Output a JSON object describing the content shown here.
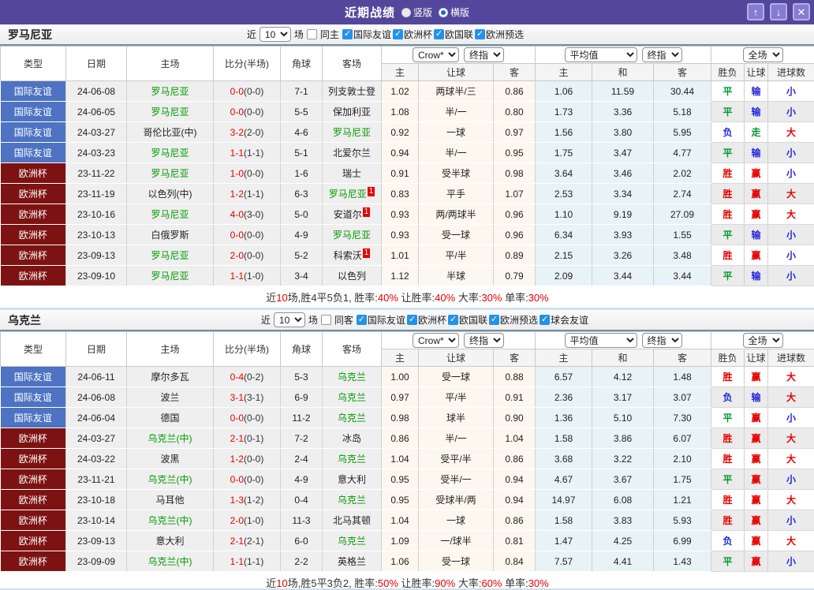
{
  "titlebar": {
    "title": "近期战绩",
    "radio_vertical": "竖版",
    "radio_horizontal": "横版",
    "selected_mode": "横版",
    "button_up": "↑",
    "button_down": "↓",
    "button_close": "✕"
  },
  "palette": {
    "titlebar_purple": "#54479b",
    "friendly_blue": "#4d73c2",
    "eurocup_dark_red": "#7d1212",
    "team_green": "#009900",
    "score_red": "#e60000",
    "result_red": "#e60000",
    "result_green": "#009933",
    "result_blue": "#2626d9",
    "checkbox_blue": "#2492ea"
  },
  "header": {
    "bookmaker_dd": "Crow*",
    "final_dd": "终指",
    "avg_dd": "平均值",
    "avg_final_dd": "终指",
    "scope_dd": "全场",
    "col_type": "类型",
    "col_date": "日期",
    "col_home": "主场",
    "col_score": "比分(半场)",
    "col_corner": "角球",
    "col_away": "客场",
    "col_odds_home": "主",
    "col_odds_hcp": "让球",
    "col_odds_away": "客",
    "col_avg_home": "主",
    "col_avg_draw": "和",
    "col_avg_away": "客",
    "col_res_wdl": "胜负",
    "col_res_hcp": "让球",
    "col_res_goals": "进球数"
  },
  "sections": [
    {
      "team": "罗马尼亚",
      "filters": {
        "recent_label": "近",
        "count": "10",
        "games_label": "场",
        "same_label": "同主",
        "same_checked": false,
        "leagues": [
          "国际友谊",
          "欧洲杯",
          "欧国联",
          "欧洲预选"
        ]
      },
      "rows": [
        {
          "type": "国际友谊",
          "tc": "blue",
          "date": "24-06-08",
          "home": {
            "t": "罗马尼亚",
            "hl": true
          },
          "score": [
            "0-0",
            "0-0"
          ],
          "corner": "7-1",
          "away": {
            "t": "列支敦士登",
            "hl": false
          },
          "odds": [
            "1.02",
            "两球半/三",
            "0.86"
          ],
          "avg": [
            "1.06",
            "11.59",
            "30.44"
          ],
          "res": [
            [
              "平",
              "g"
            ],
            [
              "输",
              "b"
            ],
            [
              "小",
              "b"
            ]
          ]
        },
        {
          "type": "国际友谊",
          "tc": "blue",
          "date": "24-06-05",
          "home": {
            "t": "罗马尼亚",
            "hl": true
          },
          "score": [
            "0-0",
            "0-0"
          ],
          "corner": "5-5",
          "away": {
            "t": "保加利亚",
            "hl": false
          },
          "odds": [
            "1.08",
            "半/一",
            "0.80"
          ],
          "avg": [
            "1.73",
            "3.36",
            "5.18"
          ],
          "res": [
            [
              "平",
              "g"
            ],
            [
              "输",
              "b"
            ],
            [
              "小",
              "b"
            ]
          ]
        },
        {
          "type": "国际友谊",
          "tc": "blue",
          "date": "24-03-27",
          "home": {
            "t": "哥伦比亚(中)",
            "hl": false
          },
          "score": [
            "3-2",
            "2-0"
          ],
          "corner": "4-6",
          "away": {
            "t": "罗马尼亚",
            "hl": true
          },
          "odds": [
            "0.92",
            "一球",
            "0.97"
          ],
          "avg": [
            "1.56",
            "3.80",
            "5.95"
          ],
          "res": [
            [
              "负",
              "b"
            ],
            [
              "走",
              "g"
            ],
            [
              "大",
              "r"
            ]
          ]
        },
        {
          "type": "国际友谊",
          "tc": "blue",
          "date": "24-03-23",
          "home": {
            "t": "罗马尼亚",
            "hl": true
          },
          "score": [
            "1-1",
            "1-1"
          ],
          "corner": "5-1",
          "away": {
            "t": "北爱尔兰",
            "hl": false
          },
          "odds": [
            "0.94",
            "半/一",
            "0.95"
          ],
          "avg": [
            "1.75",
            "3.47",
            "4.77"
          ],
          "res": [
            [
              "平",
              "g"
            ],
            [
              "输",
              "b"
            ],
            [
              "小",
              "b"
            ]
          ]
        },
        {
          "type": "欧洲杯",
          "tc": "dred",
          "date": "23-11-22",
          "home": {
            "t": "罗马尼亚",
            "hl": true
          },
          "score": [
            "1-0",
            "0-0"
          ],
          "corner": "1-6",
          "away": {
            "t": "瑞士",
            "hl": false
          },
          "odds": [
            "0.91",
            "受半球",
            "0.98"
          ],
          "avg": [
            "3.64",
            "3.46",
            "2.02"
          ],
          "res": [
            [
              "胜",
              "r"
            ],
            [
              "赢",
              "r"
            ],
            [
              "小",
              "b"
            ]
          ]
        },
        {
          "type": "欧洲杯",
          "tc": "dred",
          "date": "23-11-19",
          "home": {
            "t": "以色列(中)",
            "hl": false
          },
          "score": [
            "1-2",
            "1-1"
          ],
          "corner": "6-3",
          "away": {
            "t": "罗马尼亚",
            "hl": true,
            "rc": "1"
          },
          "odds": [
            "0.83",
            "平手",
            "1.07"
          ],
          "avg": [
            "2.53",
            "3.34",
            "2.74"
          ],
          "res": [
            [
              "胜",
              "r"
            ],
            [
              "赢",
              "r"
            ],
            [
              "大",
              "r"
            ]
          ]
        },
        {
          "type": "欧洲杯",
          "tc": "dred",
          "date": "23-10-16",
          "home": {
            "t": "罗马尼亚",
            "hl": true
          },
          "score": [
            "4-0",
            "3-0"
          ],
          "corner": "5-0",
          "away": {
            "t": "安道尔",
            "hl": false,
            "rc": "1"
          },
          "odds": [
            "0.93",
            "两/两球半",
            "0.96"
          ],
          "avg": [
            "1.10",
            "9.19",
            "27.09"
          ],
          "res": [
            [
              "胜",
              "r"
            ],
            [
              "赢",
              "r"
            ],
            [
              "大",
              "r"
            ]
          ]
        },
        {
          "type": "欧洲杯",
          "tc": "dred",
          "date": "23-10-13",
          "home": {
            "t": "白俄罗斯",
            "hl": false
          },
          "score": [
            "0-0",
            "0-0"
          ],
          "corner": "4-9",
          "away": {
            "t": "罗马尼亚",
            "hl": true
          },
          "odds": [
            "0.93",
            "受一球",
            "0.96"
          ],
          "avg": [
            "6.34",
            "3.93",
            "1.55"
          ],
          "res": [
            [
              "平",
              "g"
            ],
            [
              "输",
              "b"
            ],
            [
              "小",
              "b"
            ]
          ]
        },
        {
          "type": "欧洲杯",
          "tc": "dred",
          "date": "23-09-13",
          "home": {
            "t": "罗马尼亚",
            "hl": true
          },
          "score": [
            "2-0",
            "0-0"
          ],
          "corner": "5-2",
          "away": {
            "t": "科索沃",
            "hl": false,
            "rc": "1"
          },
          "odds": [
            "1.01",
            "平/半",
            "0.89"
          ],
          "avg": [
            "2.15",
            "3.26",
            "3.48"
          ],
          "res": [
            [
              "胜",
              "r"
            ],
            [
              "赢",
              "r"
            ],
            [
              "小",
              "b"
            ]
          ]
        },
        {
          "type": "欧洲杯",
          "tc": "dred",
          "date": "23-09-10",
          "home": {
            "t": "罗马尼亚",
            "hl": true
          },
          "score": [
            "1-1",
            "1-0"
          ],
          "corner": "3-4",
          "away": {
            "t": "以色列",
            "hl": false
          },
          "odds": [
            "1.12",
            "半球",
            "0.79"
          ],
          "avg": [
            "2.09",
            "3.44",
            "3.44"
          ],
          "res": [
            [
              "平",
              "g"
            ],
            [
              "输",
              "b"
            ],
            [
              "小",
              "b"
            ]
          ]
        }
      ],
      "summary": [
        [
          "近",
          0
        ],
        [
          "10",
          1
        ],
        [
          "场,胜4平5负1, 胜率:",
          0
        ],
        [
          "40%",
          1
        ],
        [
          " 让胜率:",
          0
        ],
        [
          "40%",
          1
        ],
        [
          " 大率:",
          0
        ],
        [
          "30%",
          1
        ],
        [
          " 单率:",
          0
        ],
        [
          "30%",
          1
        ]
      ]
    },
    {
      "team": "乌克兰",
      "filters": {
        "recent_label": "近",
        "count": "10",
        "games_label": "场",
        "same_label": "同客",
        "same_checked": false,
        "leagues": [
          "国际友谊",
          "欧洲杯",
          "欧国联",
          "欧洲预选",
          "球会友谊"
        ]
      },
      "rows": [
        {
          "type": "国际友谊",
          "tc": "blue",
          "date": "24-06-11",
          "home": {
            "t": "摩尔多瓦",
            "hl": false
          },
          "score": [
            "0-4",
            "0-2"
          ],
          "corner": "5-3",
          "away": {
            "t": "乌克兰",
            "hl": true
          },
          "odds": [
            "1.00",
            "受一球",
            "0.88"
          ],
          "avg": [
            "6.57",
            "4.12",
            "1.48"
          ],
          "res": [
            [
              "胜",
              "r"
            ],
            [
              "赢",
              "r"
            ],
            [
              "大",
              "r"
            ]
          ]
        },
        {
          "type": "国际友谊",
          "tc": "blue",
          "date": "24-06-08",
          "home": {
            "t": "波兰",
            "hl": false
          },
          "score": [
            "3-1",
            "3-1"
          ],
          "corner": "6-9",
          "away": {
            "t": "乌克兰",
            "hl": true
          },
          "odds": [
            "0.97",
            "平/半",
            "0.91"
          ],
          "avg": [
            "2.36",
            "3.17",
            "3.07"
          ],
          "res": [
            [
              "负",
              "b"
            ],
            [
              "输",
              "b"
            ],
            [
              "大",
              "r"
            ]
          ]
        },
        {
          "type": "国际友谊",
          "tc": "blue",
          "date": "24-06-04",
          "home": {
            "t": "德国",
            "hl": false
          },
          "score": [
            "0-0",
            "0-0"
          ],
          "corner": "11-2",
          "away": {
            "t": "乌克兰",
            "hl": true
          },
          "odds": [
            "0.98",
            "球半",
            "0.90"
          ],
          "avg": [
            "1.36",
            "5.10",
            "7.30"
          ],
          "res": [
            [
              "平",
              "g"
            ],
            [
              "赢",
              "r"
            ],
            [
              "小",
              "b"
            ]
          ]
        },
        {
          "type": "欧洲杯",
          "tc": "dred",
          "date": "24-03-27",
          "home": {
            "t": "乌克兰(中)",
            "hl": true
          },
          "score": [
            "2-1",
            "0-1"
          ],
          "corner": "7-2",
          "away": {
            "t": "冰岛",
            "hl": false
          },
          "odds": [
            "0.86",
            "半/一",
            "1.04"
          ],
          "avg": [
            "1.58",
            "3.86",
            "6.07"
          ],
          "res": [
            [
              "胜",
              "r"
            ],
            [
              "赢",
              "r"
            ],
            [
              "大",
              "r"
            ]
          ]
        },
        {
          "type": "欧洲杯",
          "tc": "dred",
          "date": "24-03-22",
          "home": {
            "t": "波黑",
            "hl": false
          },
          "score": [
            "1-2",
            "0-0"
          ],
          "corner": "2-4",
          "away": {
            "t": "乌克兰",
            "hl": true
          },
          "odds": [
            "1.04",
            "受平/半",
            "0.86"
          ],
          "avg": [
            "3.68",
            "3.22",
            "2.10"
          ],
          "res": [
            [
              "胜",
              "r"
            ],
            [
              "赢",
              "r"
            ],
            [
              "大",
              "r"
            ]
          ]
        },
        {
          "type": "欧洲杯",
          "tc": "dred",
          "date": "23-11-21",
          "home": {
            "t": "乌克兰(中)",
            "hl": true
          },
          "score": [
            "0-0",
            "0-0"
          ],
          "corner": "4-9",
          "away": {
            "t": "意大利",
            "hl": false
          },
          "odds": [
            "0.95",
            "受半/一",
            "0.94"
          ],
          "avg": [
            "4.67",
            "3.67",
            "1.75"
          ],
          "res": [
            [
              "平",
              "g"
            ],
            [
              "赢",
              "r"
            ],
            [
              "小",
              "b"
            ]
          ]
        },
        {
          "type": "欧洲杯",
          "tc": "dred",
          "date": "23-10-18",
          "home": {
            "t": "马耳他",
            "hl": false
          },
          "score": [
            "1-3",
            "1-2"
          ],
          "corner": "0-4",
          "away": {
            "t": "乌克兰",
            "hl": true
          },
          "odds": [
            "0.95",
            "受球半/两",
            "0.94"
          ],
          "avg": [
            "14.97",
            "6.08",
            "1.21"
          ],
          "res": [
            [
              "胜",
              "r"
            ],
            [
              "赢",
              "r"
            ],
            [
              "大",
              "r"
            ]
          ]
        },
        {
          "type": "欧洲杯",
          "tc": "dred",
          "date": "23-10-14",
          "home": {
            "t": "乌克兰(中)",
            "hl": true
          },
          "score": [
            "2-0",
            "1-0"
          ],
          "corner": "11-3",
          "away": {
            "t": "北马其顿",
            "hl": false
          },
          "odds": [
            "1.04",
            "一球",
            "0.86"
          ],
          "avg": [
            "1.58",
            "3.83",
            "5.93"
          ],
          "res": [
            [
              "胜",
              "r"
            ],
            [
              "赢",
              "r"
            ],
            [
              "小",
              "b"
            ]
          ]
        },
        {
          "type": "欧洲杯",
          "tc": "dred",
          "date": "23-09-13",
          "home": {
            "t": "意大利",
            "hl": false
          },
          "score": [
            "2-1",
            "2-1"
          ],
          "corner": "6-0",
          "away": {
            "t": "乌克兰",
            "hl": true
          },
          "odds": [
            "1.09",
            "一/球半",
            "0.81"
          ],
          "avg": [
            "1.47",
            "4.25",
            "6.99"
          ],
          "res": [
            [
              "负",
              "b"
            ],
            [
              "赢",
              "r"
            ],
            [
              "大",
              "r"
            ]
          ]
        },
        {
          "type": "欧洲杯",
          "tc": "dred",
          "date": "23-09-09",
          "home": {
            "t": "乌克兰(中)",
            "hl": true
          },
          "score": [
            "1-1",
            "1-1"
          ],
          "corner": "2-2",
          "away": {
            "t": "英格兰",
            "hl": false
          },
          "odds": [
            "1.06",
            "受一球",
            "0.84"
          ],
          "avg": [
            "7.57",
            "4.41",
            "1.43"
          ],
          "res": [
            [
              "平",
              "g"
            ],
            [
              "赢",
              "r"
            ],
            [
              "小",
              "b"
            ]
          ]
        }
      ],
      "summary": [
        [
          "近",
          0
        ],
        [
          "10",
          1
        ],
        [
          "场,胜5平3负2, 胜率:",
          0
        ],
        [
          "50%",
          1
        ],
        [
          " 让胜率:",
          0
        ],
        [
          "90%",
          1
        ],
        [
          " 大率:",
          0
        ],
        [
          "60%",
          1
        ],
        [
          " 单率:",
          0
        ],
        [
          "30%",
          1
        ]
      ]
    }
  ]
}
